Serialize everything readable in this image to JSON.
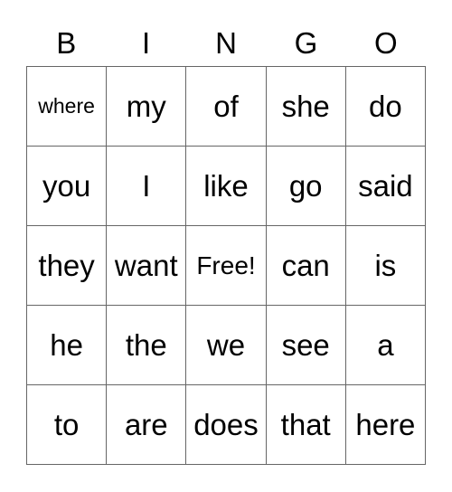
{
  "header": [
    "B",
    "I",
    "N",
    "G",
    "O"
  ],
  "rows": [
    [
      "where",
      "my",
      "of",
      "she",
      "do"
    ],
    [
      "you",
      "I",
      "like",
      "go",
      "said"
    ],
    [
      "they",
      "want",
      "Free!",
      "can",
      "is"
    ],
    [
      "he",
      "the",
      "we",
      "see",
      "a"
    ],
    [
      "to",
      "are",
      "does",
      "that",
      "here"
    ]
  ]
}
